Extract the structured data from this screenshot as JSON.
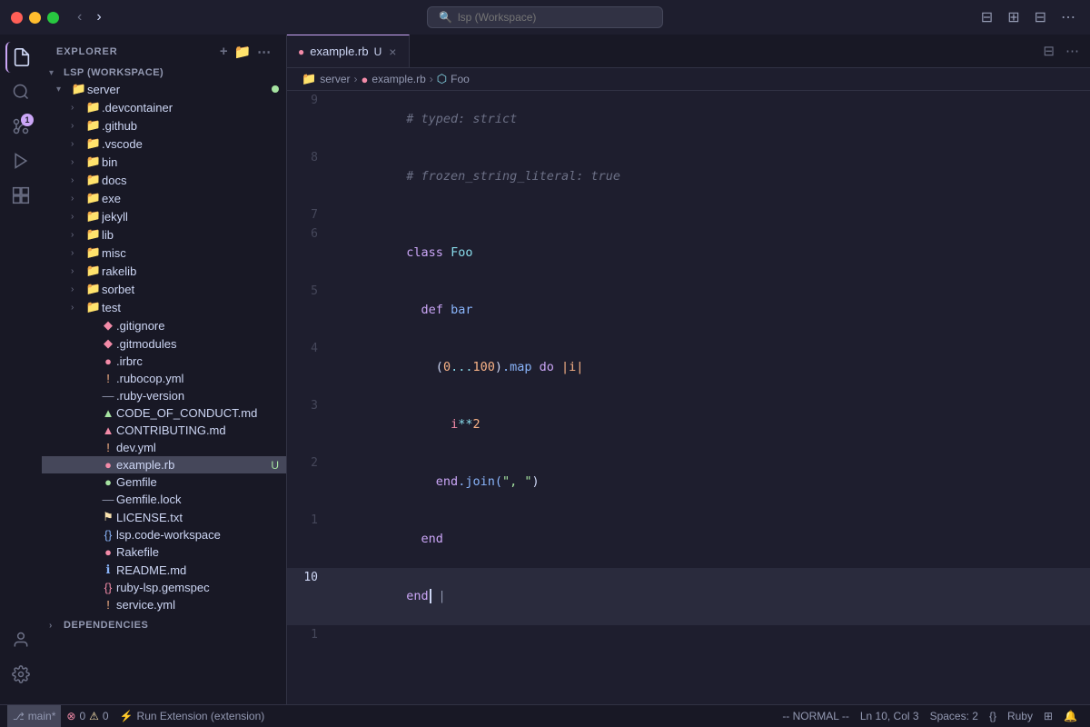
{
  "titlebar": {
    "search_placeholder": "lsp (Workspace)",
    "nav_back": "‹",
    "nav_forward": "›"
  },
  "activity_bar": {
    "icons": [
      {
        "name": "explorer",
        "symbol": "⎘",
        "active": true
      },
      {
        "name": "search",
        "symbol": "🔍"
      },
      {
        "name": "source-control",
        "symbol": "⎇",
        "badge": "1"
      },
      {
        "name": "run-debug",
        "symbol": "▷"
      },
      {
        "name": "extensions",
        "symbol": "⊞"
      }
    ],
    "bottom_icons": [
      {
        "name": "accounts",
        "symbol": "👤"
      },
      {
        "name": "settings",
        "symbol": "⚙"
      }
    ]
  },
  "sidebar": {
    "title": "EXPLORER",
    "workspace_name": "LSP (WORKSPACE)",
    "tree": [
      {
        "type": "folder",
        "label": "server",
        "indent": 1,
        "expanded": true,
        "has_dot": true
      },
      {
        "type": "folder",
        "label": ".devcontainer",
        "indent": 2,
        "expanded": false
      },
      {
        "type": "folder",
        "label": ".github",
        "indent": 2,
        "expanded": false
      },
      {
        "type": "folder",
        "label": ".vscode",
        "indent": 2,
        "expanded": false
      },
      {
        "type": "folder",
        "label": "bin",
        "indent": 2,
        "expanded": false
      },
      {
        "type": "folder",
        "label": "docs",
        "indent": 2,
        "expanded": false
      },
      {
        "type": "folder",
        "label": "exe",
        "indent": 2,
        "expanded": false
      },
      {
        "type": "folder",
        "label": "jekyll",
        "indent": 2,
        "expanded": false
      },
      {
        "type": "folder",
        "label": "lib",
        "indent": 2,
        "expanded": false
      },
      {
        "type": "folder",
        "label": "misc",
        "indent": 2,
        "expanded": false
      },
      {
        "type": "folder",
        "label": "rakelib",
        "indent": 2,
        "expanded": false
      },
      {
        "type": "folder",
        "label": "sorbet",
        "indent": 2,
        "expanded": false
      },
      {
        "type": "folder",
        "label": "test",
        "indent": 2,
        "expanded": false
      },
      {
        "type": "file",
        "label": ".gitignore",
        "indent": 2,
        "icon": "git",
        "icon_char": "◆"
      },
      {
        "type": "file",
        "label": ".gitmodules",
        "indent": 2,
        "icon": "git",
        "icon_char": "◆"
      },
      {
        "type": "file",
        "label": ".irbrc",
        "indent": 2,
        "icon": "ruby",
        "icon_char": "●"
      },
      {
        "type": "file",
        "label": ".rubocop.yml",
        "indent": 2,
        "icon": "rubocop",
        "icon_char": "!"
      },
      {
        "type": "file",
        "label": ".ruby-version",
        "indent": 2,
        "icon": "lock",
        "icon_char": "—"
      },
      {
        "type": "file",
        "label": "CODE_OF_CONDUCT.md",
        "indent": 2,
        "icon": "md",
        "icon_char": "▲"
      },
      {
        "type": "file",
        "label": "CONTRIBUTING.md",
        "indent": 2,
        "icon": "md",
        "icon_char": "▲"
      },
      {
        "type": "file",
        "label": "dev.yml",
        "indent": 2,
        "icon": "yml",
        "icon_char": "!"
      },
      {
        "type": "file",
        "label": "example.rb",
        "indent": 2,
        "icon": "ruby",
        "icon_char": "●",
        "active": true,
        "badge": "U"
      },
      {
        "type": "file",
        "label": "Gemfile",
        "indent": 2,
        "icon": "gem",
        "icon_char": "●"
      },
      {
        "type": "file",
        "label": "Gemfile.lock",
        "indent": 2,
        "icon": "lock",
        "icon_char": "—"
      },
      {
        "type": "file",
        "label": "LICENSE.txt",
        "indent": 2,
        "icon": "license",
        "icon_char": "⚑"
      },
      {
        "type": "file",
        "label": "lsp.code-workspace",
        "indent": 2,
        "icon": "workspace",
        "icon_char": "{}"
      },
      {
        "type": "file",
        "label": "Rakefile",
        "indent": 2,
        "icon": "ruby",
        "icon_char": "●"
      },
      {
        "type": "file",
        "label": "README.md",
        "indent": 2,
        "icon": "md",
        "icon_char": "ℹ"
      },
      {
        "type": "file",
        "label": "ruby-lsp.gemspec",
        "indent": 2,
        "icon": "gemspec",
        "icon_char": "{}"
      },
      {
        "type": "file",
        "label": "service.yml",
        "indent": 2,
        "icon": "yml",
        "icon_char": "!"
      }
    ],
    "dependencies_label": "DEPENDENCIES"
  },
  "editor": {
    "tab": {
      "label": "example.rb",
      "icon": "●",
      "icon_color": "#f38ba8",
      "modified": true,
      "modified_char": "U"
    },
    "breadcrumb": [
      {
        "label": "server",
        "icon": "📁"
      },
      {
        "label": "example.rb",
        "icon": "●"
      },
      {
        "label": "Foo",
        "icon": "⬡"
      }
    ],
    "lines": [
      {
        "num": "9",
        "tokens": [
          {
            "text": "# typed: strict",
            "cls": "cm"
          }
        ]
      },
      {
        "num": "8",
        "tokens": [
          {
            "text": "# frozen_string_literal: true",
            "cls": "cm"
          }
        ]
      },
      {
        "num": "7",
        "tokens": []
      },
      {
        "num": "6",
        "tokens": [
          {
            "text": "class ",
            "cls": "kw"
          },
          {
            "text": "Foo",
            "cls": "kw2"
          }
        ]
      },
      {
        "num": "5",
        "tokens": [
          {
            "text": "  "
          },
          {
            "text": "def ",
            "cls": "kw"
          },
          {
            "text": "bar",
            "cls": "fn"
          }
        ]
      },
      {
        "num": "4",
        "tokens": [
          {
            "text": "    "
          },
          {
            "text": "(",
            "cls": "pun"
          },
          {
            "text": "0",
            "cls": "num"
          },
          {
            "text": "...",
            "cls": "op"
          },
          {
            "text": "100",
            "cls": "num"
          },
          {
            "text": ")",
            "cls": "pun"
          },
          {
            "text": ".map ",
            "cls": "mth"
          },
          {
            "text": "do ",
            "cls": "kw"
          },
          {
            "text": "|i|",
            "cls": "blk"
          }
        ]
      },
      {
        "num": "3",
        "tokens": [
          {
            "text": "      "
          },
          {
            "text": "i",
            "cls": "var"
          },
          {
            "text": "**",
            "cls": "op"
          },
          {
            "text": "2",
            "cls": "num"
          }
        ]
      },
      {
        "num": "2",
        "tokens": [
          {
            "text": "    "
          },
          {
            "text": "end",
            "cls": "kw"
          },
          {
            "text": ".join(",
            "cls": "mth"
          },
          {
            "text": "\", \"",
            "cls": "str"
          },
          {
            "text": ")",
            "cls": "pun"
          }
        ]
      },
      {
        "num": "1",
        "tokens": [
          {
            "text": "  "
          },
          {
            "text": "end",
            "cls": "kw"
          }
        ]
      },
      {
        "num": "10",
        "tokens": [
          {
            "text": "end",
            "cls": "kw"
          }
        ],
        "cursor": true
      },
      {
        "num": "1",
        "tokens": []
      }
    ]
  },
  "statusbar": {
    "branch": "main*",
    "errors": "0",
    "warnings": "0",
    "run_task": "Run Extension (extension)",
    "vim_mode": "-- NORMAL --",
    "position": "Ln 10, Col 3",
    "spaces": "Spaces: 2",
    "encoding": "{}",
    "language": "Ruby",
    "layout_icon": "⊞",
    "notifications": "🔔"
  }
}
